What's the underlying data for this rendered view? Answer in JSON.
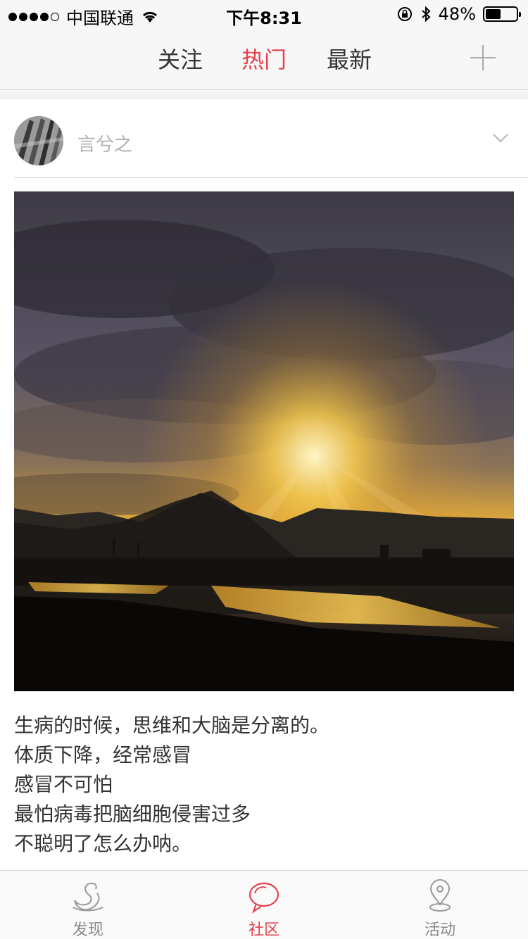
{
  "status": {
    "carrier": "中国联通",
    "time": "下午8:31",
    "battery": "48%",
    "battery_level": 0.48
  },
  "nav": {
    "tabs": [
      {
        "label": "关注",
        "active": false
      },
      {
        "label": "热门",
        "active": true
      },
      {
        "label": "最新",
        "active": false
      }
    ],
    "add_icon": "plus-icon"
  },
  "post": {
    "username": "言兮之",
    "caption_lines": [
      "生病的时候，思维和大脑是分离的。",
      "体质下降，经常感冒",
      "感冒不可怕",
      "最怕病毒把脑细胞侵害过多",
      "不聪明了怎么办呐。"
    ]
  },
  "tabbar": {
    "items": [
      {
        "label": "发现",
        "icon": "swan-icon",
        "active": false
      },
      {
        "label": "社区",
        "icon": "chat-bubble-icon",
        "active": true
      },
      {
        "label": "活动",
        "icon": "location-pin-icon",
        "active": false
      }
    ]
  },
  "colors": {
    "accent": "#e2434c",
    "inactive": "#888888"
  }
}
